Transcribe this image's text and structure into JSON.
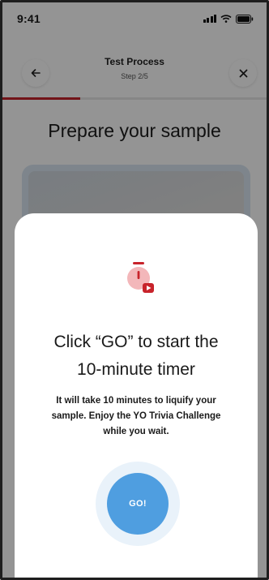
{
  "status_bar": {
    "time": "9:41"
  },
  "header": {
    "title": "Test Process",
    "step": "Step 2/5"
  },
  "progress": {
    "fraction": 0.4,
    "color": "#c4232b"
  },
  "page": {
    "heading": "Prepare your sample"
  },
  "modal": {
    "title_line1": "Click “GO” to start the",
    "title_line2": "10-minute timer",
    "body_line1": "It will take 10 minutes to liquify your",
    "body_line2": "sample. Enjoy the YO Trivia Challenge",
    "body_line3": "while you wait.",
    "go_label": "GO!",
    "button_color": "#4f9ee0",
    "icon": "stopwatch-play-icon"
  },
  "icons": {
    "back": "arrow-left-icon",
    "close": "close-icon",
    "signal": "cellular-signal-icon",
    "wifi": "wifi-icon",
    "battery": "battery-icon"
  }
}
